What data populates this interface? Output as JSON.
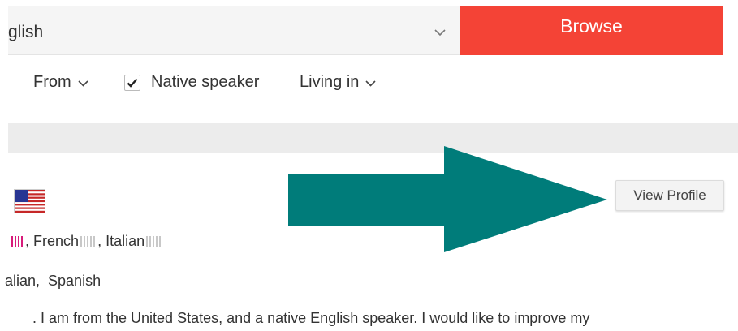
{
  "search": {
    "language_value": "glish",
    "browse_label": "Browse"
  },
  "filters": {
    "from_label": "From",
    "native_speaker_label": "Native speaker",
    "native_speaker_checked": true,
    "living_in_label": "Living in"
  },
  "profile": {
    "flag": "united-states-flag",
    "view_profile_label": "View Profile",
    "languages": [
      "French",
      "Italian"
    ],
    "separator": ",",
    "other_languages_text": "alian,  Spanish",
    "intro_text": ". I am from the United States, and a native English speaker. I would like to improve my"
  },
  "colors": {
    "browse": "#f44336",
    "arrow": "#007c7a",
    "band": "#ececec",
    "level_highlight": "#d81b7a"
  }
}
